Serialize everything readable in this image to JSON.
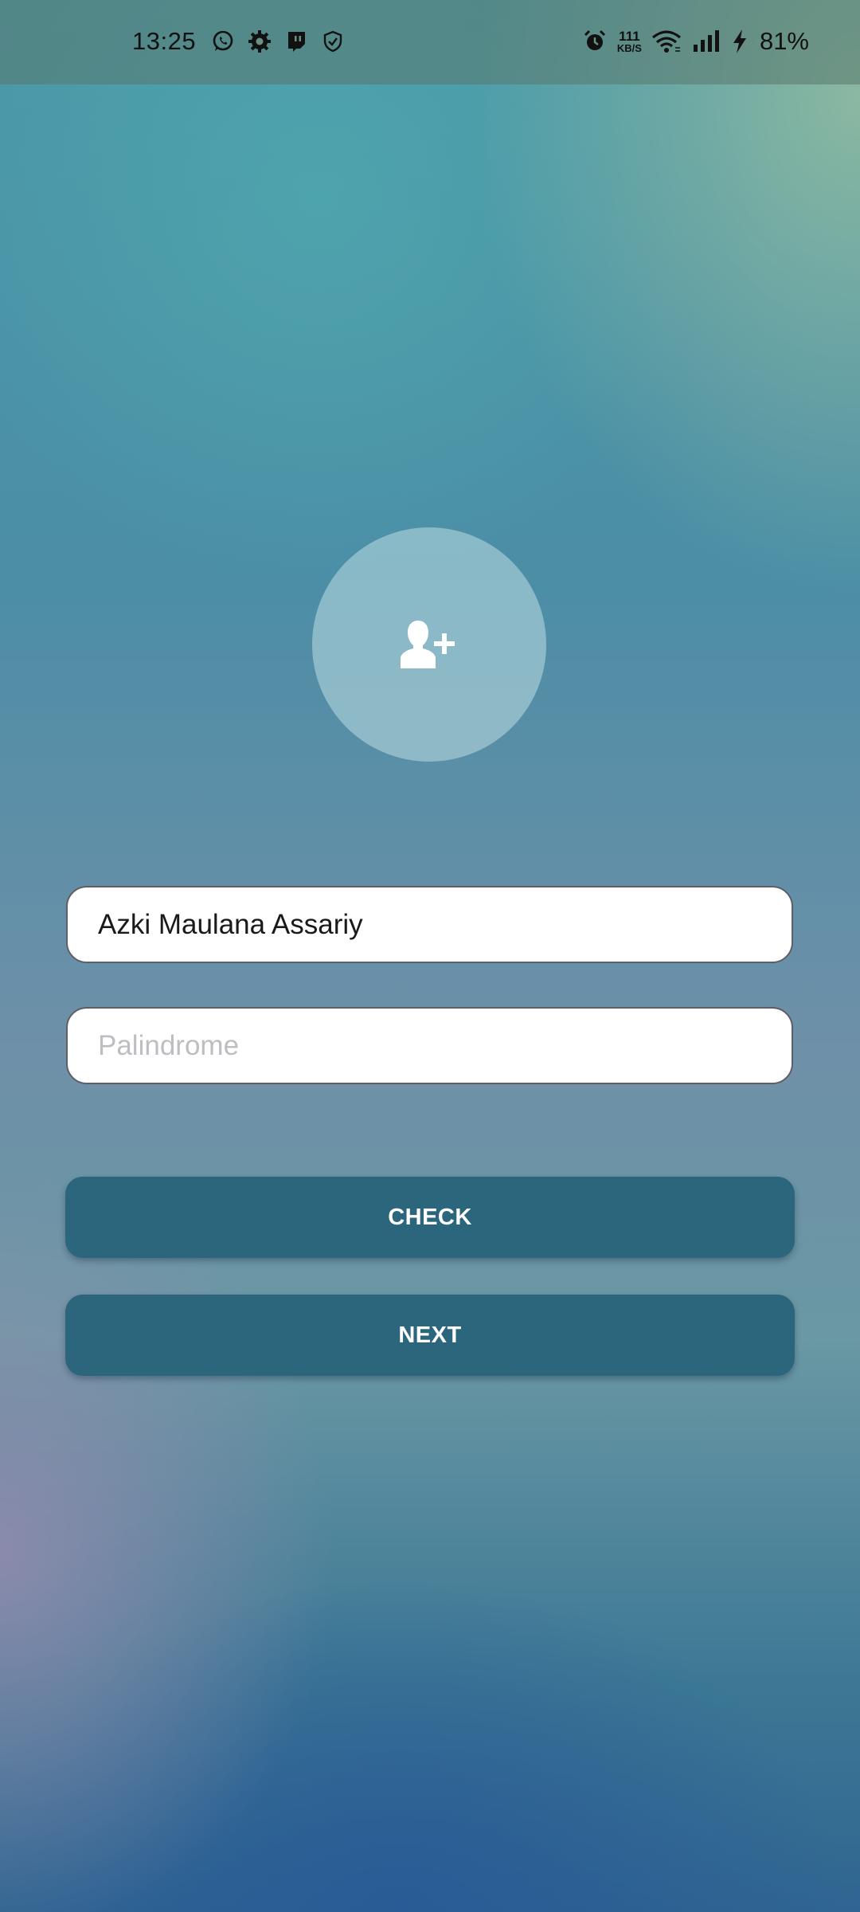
{
  "status_bar": {
    "time": "13:25",
    "net_speed_value": "111",
    "net_speed_unit": "KB/S",
    "battery": "81%",
    "left_icons": [
      "whatsapp-icon",
      "settings-gear-icon",
      "twitch-icon",
      "shield-check-icon"
    ],
    "right_icons": [
      "alarm-icon",
      "wifi-icon",
      "signal-icon",
      "charging-bolt-icon"
    ]
  },
  "avatar": {
    "icon": "add-user-icon"
  },
  "form": {
    "name_value": "Azki Maulana Assariy",
    "palindrome_placeholder": "Palindrome",
    "palindrome_value": ""
  },
  "buttons": {
    "check_label": "CHECK",
    "next_label": "NEXT"
  },
  "colors": {
    "button_bg": "#2c667d",
    "button_text": "#ffffff",
    "field_bg": "#ffffff",
    "placeholder": "#bdbdc2"
  }
}
